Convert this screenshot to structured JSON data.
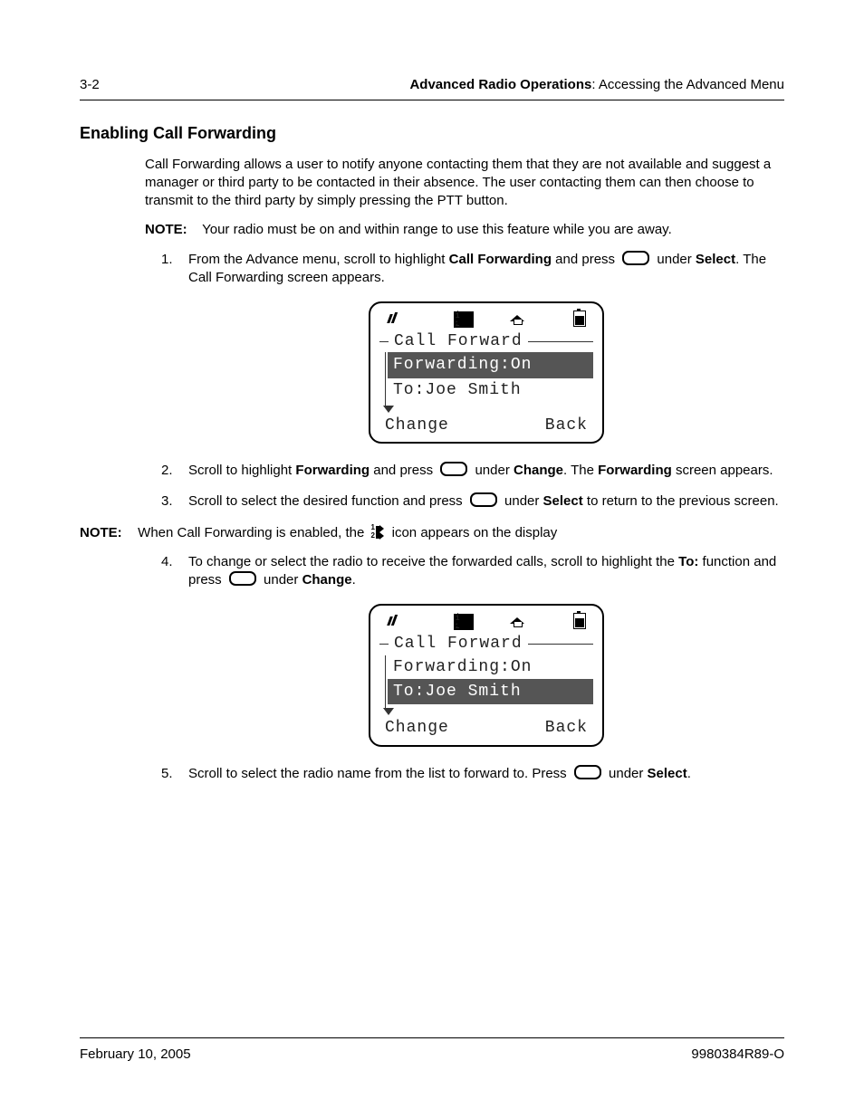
{
  "header": {
    "page_num": "3-2",
    "chapter": "Advanced Radio Operations",
    "section": "Accessing the Advanced Menu"
  },
  "title": "Enabling Call Forwarding",
  "intro": "Call Forwarding allows a user to notify anyone contacting them that they are not available and suggest a manager or third party to be contacted in their absence. The user contacting them can then choose to transmit to the third party by simply pressing the PTT button.",
  "note1": {
    "label": "NOTE:",
    "text": "Your radio must be on and within range to use this feature while you are away."
  },
  "steps": {
    "s1a": "From the Advance menu, scroll to highlight ",
    "s1b": "Call Forwarding",
    "s1c": " and press ",
    "s1d": " under ",
    "s1e": "Select",
    "s1f": ". The Call Forwarding screen appears.",
    "s2a": "Scroll to highlight ",
    "s2b": "Forwarding",
    "s2c": " and press ",
    "s2d": " under ",
    "s2e": "Change",
    "s2f": ". The ",
    "s2g": "Forwarding",
    "s2h": " screen appears.",
    "s3a": "Scroll to select the desired function and press ",
    "s3b": " under ",
    "s3c": "Select",
    "s3d": " to return to the previous screen.",
    "s4a": "To change or select the radio to receive the forwarded calls, scroll to highlight the ",
    "s4b": "To:",
    "s4c": " function and press ",
    "s4d": " under ",
    "s4e": "Change",
    "s4f": ".",
    "s5a": "Scroll to select the radio name from the list to forward to. Press ",
    "s5b": " under ",
    "s5c": "Select",
    "s5d": "."
  },
  "note2": {
    "label": "NOTE:",
    "before": "When Call Forwarding is enabled, the ",
    "after": " icon appears on the display"
  },
  "lcd1": {
    "title": "Call Forward",
    "line1": "Forwarding:On",
    "line2": "To:Joe Smith",
    "soft_left": "Change",
    "soft_right": "Back",
    "selected": 1
  },
  "lcd2": {
    "title": "Call Forward",
    "line1": "Forwarding:On",
    "line2": "To:Joe Smith",
    "soft_left": "Change",
    "soft_right": "Back",
    "selected": 2
  },
  "footer": {
    "date": "February 10, 2005",
    "docnum": "9980384R89-O"
  }
}
